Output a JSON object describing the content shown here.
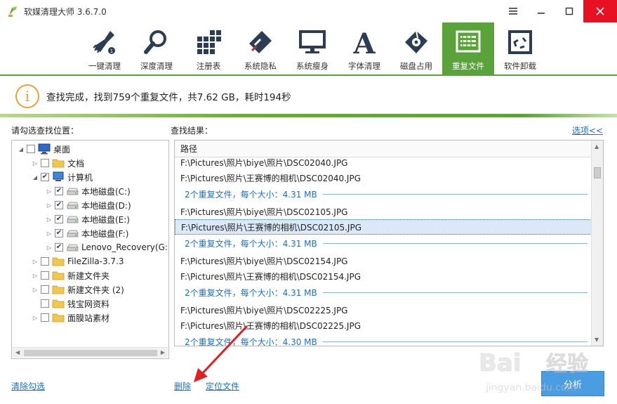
{
  "window": {
    "title": "软媒清理大师 3.6.7.0"
  },
  "toolbar": {
    "items": [
      {
        "label": "一键清理",
        "icon": "broom-icon"
      },
      {
        "label": "深度清理",
        "icon": "magnifier-icon"
      },
      {
        "label": "注册表",
        "icon": "registry-grid-icon"
      },
      {
        "label": "系统隐私",
        "icon": "eraser-icon"
      },
      {
        "label": "系统瘦身",
        "icon": "monitor-icon"
      },
      {
        "label": "字体清理",
        "icon": "font-a-icon"
      },
      {
        "label": "磁盘占用",
        "icon": "disk-icon"
      },
      {
        "label": "重复文件",
        "icon": "duplicate-files-icon"
      },
      {
        "label": "软件卸载",
        "icon": "recycle-bin-icon"
      }
    ],
    "active_index": 7,
    "accent": "#5aa23a"
  },
  "status": {
    "icon": "info-icon",
    "text": "查找完成，找到759个重复文件，共7.62 GB，耗时194秒"
  },
  "left_panel": {
    "title": "请勾选查找位置：",
    "tree": [
      {
        "label": "桌面",
        "depth": 0,
        "expander": "open",
        "checked": false,
        "icon": "desktop-icon"
      },
      {
        "label": "文档",
        "depth": 1,
        "expander": "closed",
        "checked": false,
        "icon": "folder-icon"
      },
      {
        "label": "计算机",
        "depth": 1,
        "expander": "open",
        "checked": true,
        "icon": "computer-icon"
      },
      {
        "label": "本地磁盘(C:)",
        "depth": 2,
        "expander": "closed",
        "checked": true,
        "icon": "drive-icon"
      },
      {
        "label": "本地磁盘(D:)",
        "depth": 2,
        "expander": "closed",
        "checked": true,
        "icon": "drive-icon"
      },
      {
        "label": "本地磁盘(E:)",
        "depth": 2,
        "expander": "closed",
        "checked": true,
        "icon": "drive-icon"
      },
      {
        "label": "本地磁盘(F:)",
        "depth": 2,
        "expander": "closed",
        "checked": true,
        "icon": "drive-icon"
      },
      {
        "label": "Lenovo_Recovery(G:)",
        "depth": 2,
        "expander": "closed",
        "checked": true,
        "icon": "drive-icon"
      },
      {
        "label": "FileZilla-3.7.3",
        "depth": 1,
        "expander": "closed",
        "checked": false,
        "icon": "folder-icon"
      },
      {
        "label": "新建文件夹",
        "depth": 1,
        "expander": "closed",
        "checked": false,
        "icon": "folder-icon"
      },
      {
        "label": "新建文件夹 (2)",
        "depth": 1,
        "expander": "closed",
        "checked": false,
        "icon": "folder-icon"
      },
      {
        "label": "钱宝网资料",
        "depth": 1,
        "expander": "none",
        "checked": false,
        "icon": "folder-icon"
      },
      {
        "label": "面膜站素材",
        "depth": 1,
        "expander": "closed",
        "checked": false,
        "icon": "folder-icon"
      }
    ],
    "clear_label": "清除勾选"
  },
  "right_panel": {
    "title": "查找结果：",
    "options_label": "选项<<",
    "column_header": "路径",
    "rows": [
      {
        "kind": "file",
        "text": "F:\\Pictures\\照片\\biye\\照片\\DSC02040.JPG",
        "selected": false
      },
      {
        "kind": "file",
        "text": "F:\\Pictures\\照片\\王赛博的相机\\DSC02040.JPG",
        "selected": false
      },
      {
        "kind": "group",
        "text": "2个重复文件，每个大小：4.31 MB"
      },
      {
        "kind": "file",
        "text": "F:\\Pictures\\照片\\biye\\照片\\DSC02105.JPG",
        "selected": false
      },
      {
        "kind": "file",
        "text": "F:\\Pictures\\照片\\王赛博的相机\\DSC02105.JPG",
        "selected": true
      },
      {
        "kind": "group",
        "text": "2个重复文件，每个大小：4.31 MB"
      },
      {
        "kind": "file",
        "text": "F:\\Pictures\\照片\\biye\\照片\\DSC02154.JPG",
        "selected": false
      },
      {
        "kind": "file",
        "text": "F:\\Pictures\\照片\\王赛博的相机\\DSC02154.JPG",
        "selected": false
      },
      {
        "kind": "group",
        "text": "2个重复文件，每个大小：4.31 MB"
      },
      {
        "kind": "file",
        "text": "F:\\Pictures\\照片\\biye\\照片\\DSC02225.JPG",
        "selected": false
      },
      {
        "kind": "file",
        "text": "F:\\Pictures\\照片\\王赛博的相机\\DSC02225.JPG",
        "selected": false
      },
      {
        "kind": "group",
        "text": "2个重复文件，每个大小：4.30 MB"
      }
    ],
    "delete_label": "删除",
    "locate_label": "定位文件",
    "analyze_label": "分析"
  },
  "watermark": {
    "text": "Bai du 经验",
    "subtext": "jingyan.baidu.com"
  },
  "colors": {
    "link": "#1a6fc9",
    "info": "#f0a030",
    "button": "#4a9de0",
    "close": "#e81123"
  }
}
